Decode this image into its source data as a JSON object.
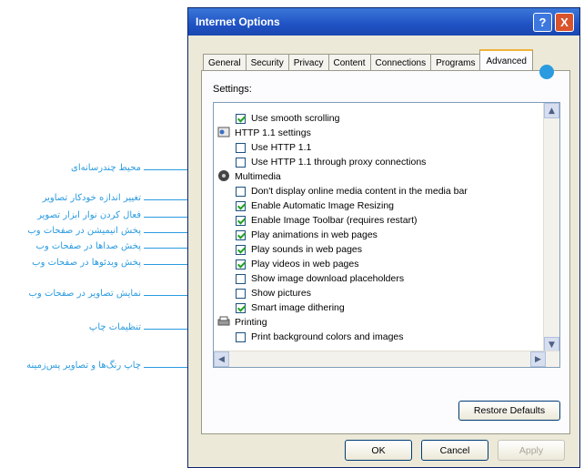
{
  "window": {
    "title": "Internet Options",
    "help_symbol": "?",
    "close_symbol": "X"
  },
  "tabs": [
    {
      "label": "General"
    },
    {
      "label": "Security"
    },
    {
      "label": "Privacy"
    },
    {
      "label": "Content"
    },
    {
      "label": "Connections"
    },
    {
      "label": "Programs"
    },
    {
      "label": "Advanced",
      "active": true
    }
  ],
  "settings": {
    "label": "Settings:",
    "rows": [
      {
        "kind": "checkbox",
        "checked": true,
        "label": "Use smooth scrolling"
      },
      {
        "kind": "category",
        "icon": "http-settings-icon",
        "label": "HTTP 1.1 settings"
      },
      {
        "kind": "checkbox",
        "checked": false,
        "label": "Use HTTP 1.1"
      },
      {
        "kind": "checkbox",
        "checked": false,
        "label": "Use HTTP 1.1 through proxy connections"
      },
      {
        "kind": "category",
        "icon": "multimedia-icon",
        "label": "Multimedia"
      },
      {
        "kind": "checkbox",
        "checked": false,
        "label": "Don't display online media content in the media bar"
      },
      {
        "kind": "checkbox",
        "checked": true,
        "label": "Enable Automatic Image Resizing"
      },
      {
        "kind": "checkbox",
        "checked": true,
        "label": "Enable Image Toolbar (requires restart)"
      },
      {
        "kind": "checkbox",
        "checked": true,
        "label": "Play animations in web pages"
      },
      {
        "kind": "checkbox",
        "checked": true,
        "label": "Play sounds in web pages"
      },
      {
        "kind": "checkbox",
        "checked": true,
        "label": "Play videos in web pages"
      },
      {
        "kind": "checkbox",
        "checked": false,
        "label": "Show image download placeholders"
      },
      {
        "kind": "checkbox",
        "checked": false,
        "label": "Show pictures"
      },
      {
        "kind": "checkbox",
        "checked": true,
        "label": "Smart image dithering"
      },
      {
        "kind": "category",
        "icon": "printer-icon",
        "label": "Printing"
      },
      {
        "kind": "checkbox",
        "checked": false,
        "label": "Print background colors and images"
      }
    ]
  },
  "buttons": {
    "restore_defaults": "Restore Defaults",
    "ok": "OK",
    "cancel": "Cancel",
    "apply": "Apply"
  },
  "annotations": [
    "محیط چندرسانه‌ای",
    "تغییر اندازه خودکار تصاویر",
    "فعال کردن نوار ابزار تصویر",
    "پخش انیمیشن در صفحات وب",
    "پخش صداها در صفحات وب",
    "پخش ویدئوها در صفحات وب",
    "نمایش تصاویر در صفحات وب",
    "تنظیمات چاپ",
    "چاپ رنگ‌ها و تصاویر پس‌زمینه"
  ],
  "colors": {
    "accent": "#2a9be0",
    "title_bar": "#1f52c4",
    "dialog_bg": "#ece9d8"
  }
}
